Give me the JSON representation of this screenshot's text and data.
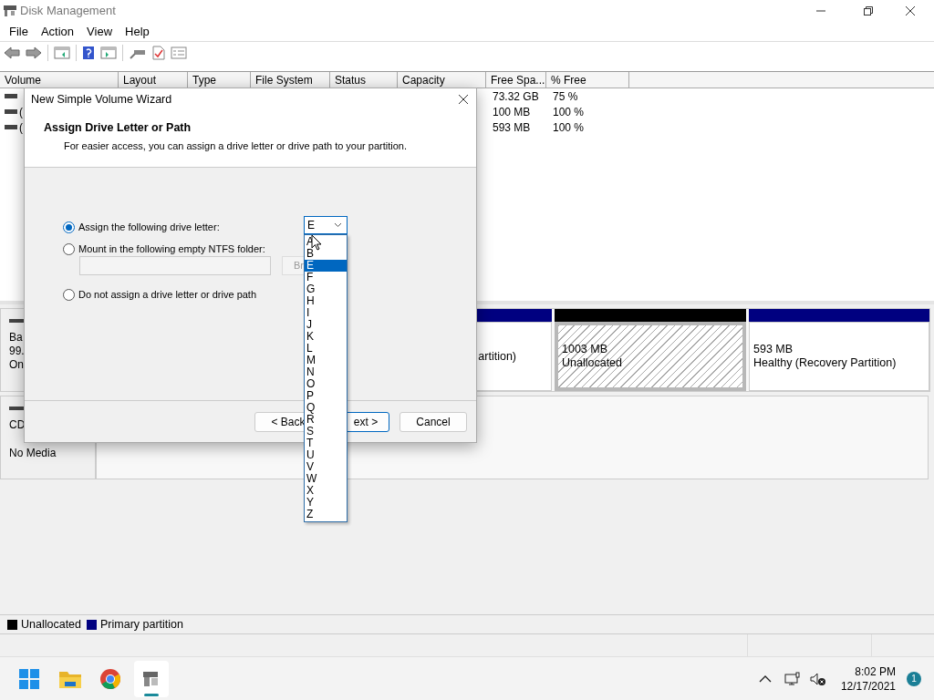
{
  "window": {
    "title": "Disk Management",
    "menu": [
      "File",
      "Action",
      "View",
      "Help"
    ]
  },
  "volume_list": {
    "columns": [
      "Volume",
      "Layout",
      "Type",
      "File System",
      "Status",
      "Capacity",
      "Free Spa...",
      "% Free"
    ],
    "rows": [
      {
        "free_space": "73.32 GB",
        "percent_free": "75 %"
      },
      {
        "volume": "(",
        "free_space": "100 MB",
        "percent_free": "100 %"
      },
      {
        "volume": "(",
        "free_space": "593 MB",
        "percent_free": "100 %"
      }
    ]
  },
  "disks": [
    {
      "label_lines": [
        "Ba",
        "99.",
        "On"
      ],
      "partitions": [
        {
          "kind": "primary",
          "lines": [
            "artition)"
          ]
        },
        {
          "kind": "unallocated",
          "lines": [
            "1003 MB",
            "Unallocated"
          ]
        },
        {
          "kind": "primary",
          "lines": [
            "593 MB",
            "Healthy (Recovery Partition)"
          ]
        }
      ]
    },
    {
      "label_lines": [
        "CD"
      ],
      "media": "No Media"
    }
  ],
  "legend": [
    {
      "label": "Unallocated",
      "color": "#000000"
    },
    {
      "label": "Primary partition",
      "color": "#000080"
    }
  ],
  "wizard": {
    "title": "New Simple Volume Wizard",
    "heading": "Assign Drive Letter or Path",
    "subheading": "For easier access, you can assign a drive letter or drive path to your partition.",
    "options": [
      {
        "label": "Assign the following drive letter:",
        "selected": true
      },
      {
        "label": "Mount in the following empty NTFS folder:",
        "selected": false
      },
      {
        "label": "Do not assign a drive letter or drive path",
        "selected": false
      }
    ],
    "browse_button": "Br",
    "drive_letter": {
      "value": "E",
      "options": [
        {
          "label": "A",
          "selected": false
        },
        {
          "label": "B",
          "selected": false
        },
        {
          "label": "E",
          "selected": true
        },
        {
          "label": "F",
          "selected": false
        },
        {
          "label": "G",
          "selected": false
        },
        {
          "label": "H",
          "selected": false
        },
        {
          "label": "I",
          "selected": false
        },
        {
          "label": "J",
          "selected": false
        },
        {
          "label": "K",
          "selected": false
        },
        {
          "label": "L",
          "selected": false
        },
        {
          "label": "M",
          "selected": false
        },
        {
          "label": "N",
          "selected": false
        },
        {
          "label": "O",
          "selected": false
        },
        {
          "label": "P",
          "selected": false
        },
        {
          "label": "Q",
          "selected": false
        },
        {
          "label": "R",
          "selected": false
        },
        {
          "label": "S",
          "selected": false
        },
        {
          "label": "T",
          "selected": false
        },
        {
          "label": "U",
          "selected": false
        },
        {
          "label": "V",
          "selected": false
        },
        {
          "label": "W",
          "selected": false
        },
        {
          "label": "X",
          "selected": false
        },
        {
          "label": "Y",
          "selected": false
        },
        {
          "label": "Z",
          "selected": false
        }
      ]
    },
    "buttons": [
      "< Back",
      "ext >",
      "Cancel"
    ]
  },
  "taskbar": {
    "time": "8:02 PM",
    "date": "12/17/2021",
    "notification_count": "1"
  }
}
